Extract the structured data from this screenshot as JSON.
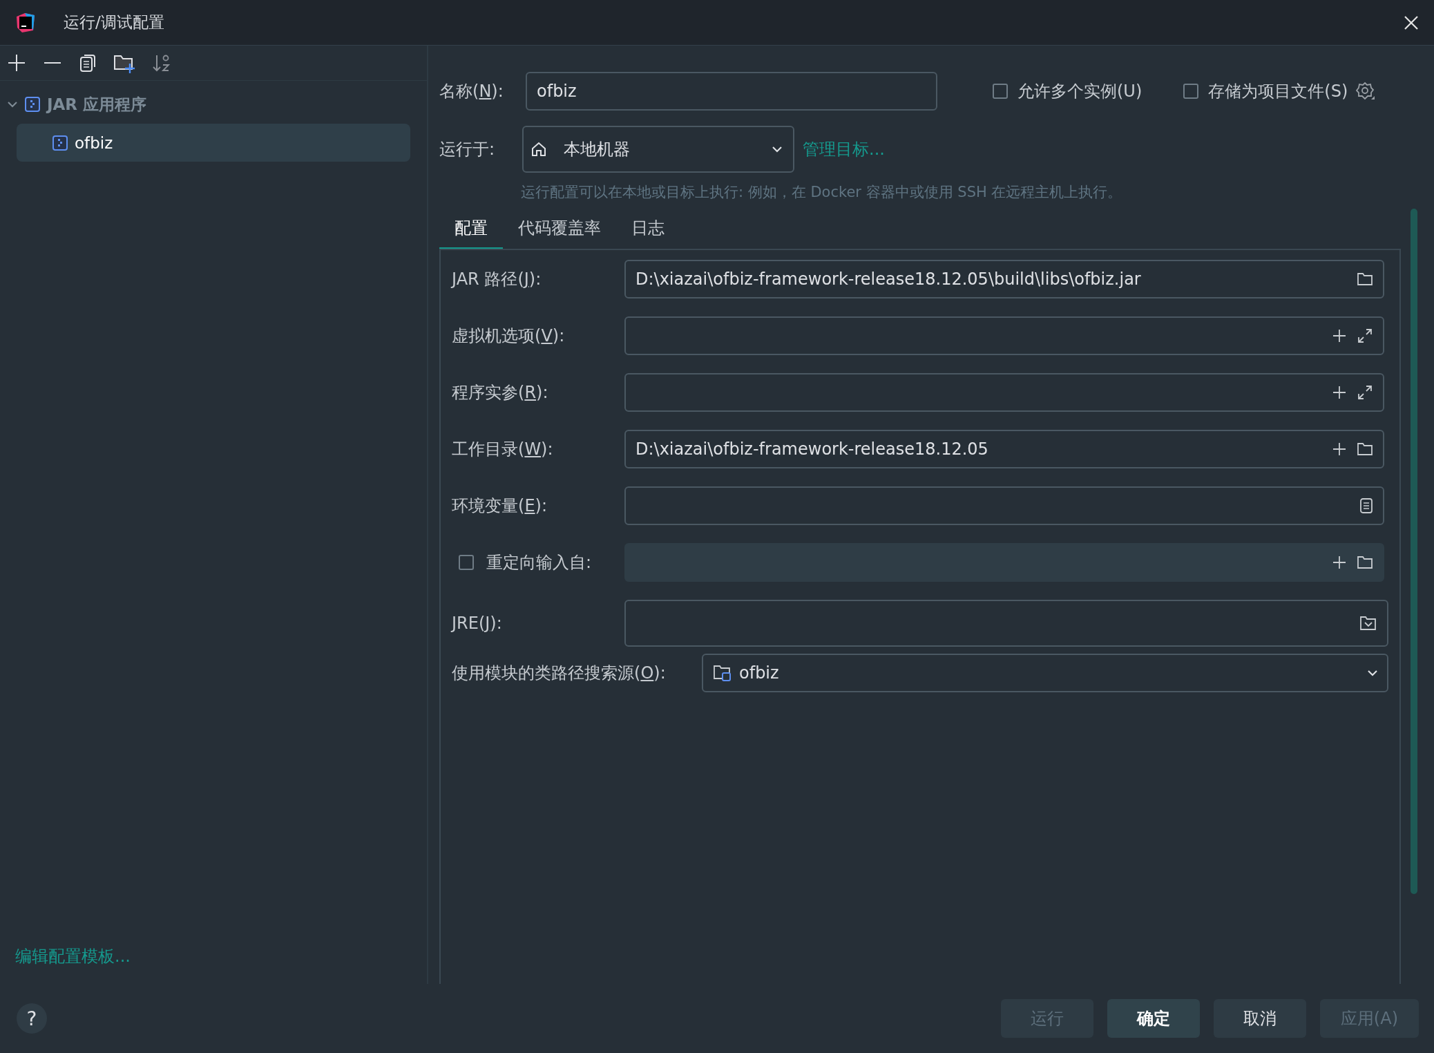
{
  "window": {
    "title": "运行/调试配置"
  },
  "tree": [
    {
      "label": "JAR 应用程序",
      "expanded": true,
      "selected": false,
      "children": [
        {
          "label": "ofbiz",
          "selected": true
        }
      ]
    }
  ],
  "edit_templates_link": "编辑配置模板...",
  "help_button": "?",
  "name_field": {
    "pre": "名称(",
    "key": "N",
    "post": "):",
    "value": "ofbiz"
  },
  "options": [
    {
      "label": "允许多个实例(U)",
      "checked": false
    },
    {
      "label": "存储为项目文件(S)",
      "checked": false
    }
  ],
  "run_on": {
    "label": "运行于:",
    "value": "本地机器",
    "manage_link": "管理目标...",
    "hint": "运行配置可以在本地或目标上执行: 例如，在 Docker 容器中或使用 SSH 在远程主机上执行。"
  },
  "tabs": [
    {
      "label": "配置",
      "selected": true
    },
    {
      "label": "代码覆盖率",
      "selected": false
    },
    {
      "label": "日志",
      "selected": false
    }
  ],
  "fields": [
    {
      "kind": "text",
      "pre": "JAR 路径(",
      "key": "J",
      "post": "):",
      "value": "D:\\xiazai\\ofbiz-framework-release18.12.05\\build\\libs\\ofbiz.jar",
      "icons": [
        {
          "kind": "folder"
        }
      ]
    },
    {
      "kind": "text",
      "pre": "虚拟机选项(",
      "key": "V",
      "post": "):",
      "icons": [
        {
          "kind": "plus"
        },
        {
          "kind": "expand"
        }
      ]
    },
    {
      "kind": "text",
      "pre": "程序实参(",
      "key": "R",
      "post": "):",
      "icons": [
        {
          "kind": "plus"
        },
        {
          "kind": "expand"
        }
      ]
    },
    {
      "kind": "text",
      "pre": "工作目录(",
      "key": "W",
      "post": "):",
      "value": "D:\\xiazai\\ofbiz-framework-release18.12.05",
      "icons": [
        {
          "kind": "plus"
        },
        {
          "kind": "folder"
        }
      ]
    },
    {
      "kind": "text",
      "pre": "环境变量(",
      "key": "E",
      "post": "):",
      "icons": [
        {
          "kind": "list"
        }
      ]
    },
    {
      "kind": "check",
      "pre": "重定向输入自:",
      "checked": false,
      "disabled": true,
      "icons": [
        {
          "kind": "plus"
        },
        {
          "kind": "folder"
        }
      ]
    },
    {
      "kind": "combo",
      "pre": "JRE(",
      "key": "J",
      "post": "):",
      "icons": [
        {
          "kind": "folder-down"
        }
      ]
    },
    {
      "kind": "module",
      "pre": "使用模块的类路径搜索源(",
      "key": "O",
      "post": "):",
      "value": "ofbiz"
    }
  ],
  "buttons": [
    {
      "label": "运行",
      "disabled": true,
      "primary": false
    },
    {
      "label": "确定",
      "disabled": false,
      "primary": true
    },
    {
      "label": "取消",
      "disabled": false,
      "primary": false
    },
    {
      "label": "应用(A)",
      "disabled": true,
      "primary": false
    }
  ]
}
